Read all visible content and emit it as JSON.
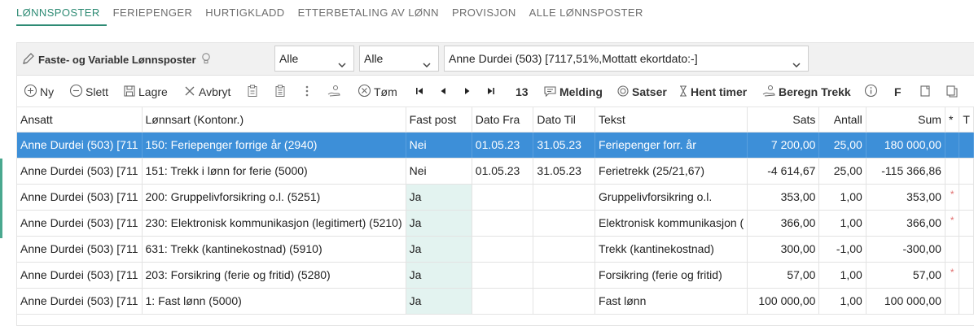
{
  "tabs": [
    {
      "label": "LØNNSPOSTER",
      "active": true
    },
    {
      "label": "FERIEPENGER",
      "active": false
    },
    {
      "label": "HURTIGKLADD",
      "active": false
    },
    {
      "label": "ETTERBETALING AV LØNN",
      "active": false
    },
    {
      "label": "PROVISJON",
      "active": false
    },
    {
      "label": "ALLE LØNNSPOSTER",
      "active": false
    }
  ],
  "filter": {
    "title": "Faste- og Variable Lønnsposter",
    "select1": "Alle",
    "select2": "Alle",
    "employee": "Anne Durdei (503) [7117,51%,Mottatt ekortdato:-]"
  },
  "toolbar": {
    "new": "Ny",
    "delete": "Slett",
    "save": "Lagre",
    "cancel": "Avbryt",
    "clear": "Tøm",
    "count": "13",
    "message": "Melding",
    "rates": "Satser",
    "fetch_hours": "Hent timer",
    "calc_tax": "Beregn Trekk",
    "f_label": "F"
  },
  "table": {
    "headers": {
      "ansatt": "Ansatt",
      "lonnsart": "Lønnsart (Kontonr.)",
      "fastpost": "Fast post",
      "datofra": "Dato Fra",
      "datotil": "Dato Til",
      "tekst": "Tekst",
      "sats": "Sats",
      "antall": "Antall",
      "sum": "Sum",
      "star": "*",
      "extra": "T"
    },
    "rows": [
      {
        "ansatt": "Anne Durdei (503) [711",
        "lonnsart": "150: Feriepenger forrige år (2940)",
        "fastpost": "Nei",
        "datofra": "01.05.23",
        "datotil": "31.05.23",
        "tekst": "Feriepenger forr. år",
        "sats": "7 200,00",
        "antall": "25,00",
        "sum": "180 000,00",
        "star": ""
      },
      {
        "ansatt": "Anne Durdei (503) [711",
        "lonnsart": "151: Trekk i lønn for ferie (5000)",
        "fastpost": "Nei",
        "datofra": "01.05.23",
        "datotil": "31.05.23",
        "tekst": "Ferietrekk (25/21,67)",
        "sats": "-4 614,67",
        "antall": "25,00",
        "sum": "-115 366,86",
        "star": ""
      },
      {
        "ansatt": "Anne Durdei (503) [711",
        "lonnsart": "200: Gruppelivforsikring o.l. (5251)",
        "fastpost": "Ja",
        "datofra": "",
        "datotil": "",
        "tekst": "Gruppelivforsikring o.l.",
        "sats": "353,00",
        "antall": "1,00",
        "sum": "353,00",
        "star": "*"
      },
      {
        "ansatt": "Anne Durdei (503) [711",
        "lonnsart": "230: Elektronisk kommunikasjon (legitimert) (5210)",
        "fastpost": "Ja",
        "datofra": "",
        "datotil": "",
        "tekst": "Elektronisk kommunikasjon (",
        "sats": "366,00",
        "antall": "1,00",
        "sum": "366,00",
        "star": "*"
      },
      {
        "ansatt": "Anne Durdei (503) [711",
        "lonnsart": "631: Trekk (kantinekostnad) (5910)",
        "fastpost": "Ja",
        "datofra": "",
        "datotil": "",
        "tekst": "Trekk (kantinekostnad)",
        "sats": "300,00",
        "antall": "-1,00",
        "sum": "-300,00",
        "star": ""
      },
      {
        "ansatt": "Anne Durdei (503) [711",
        "lonnsart": "203: Forsikring (ferie og fritid) (5280)",
        "fastpost": "Ja",
        "datofra": "",
        "datotil": "",
        "tekst": "Forsikring (ferie og fritid)",
        "sats": "57,00",
        "antall": "1,00",
        "sum": "57,00",
        "star": "*"
      },
      {
        "ansatt": "Anne Durdei (503) [711",
        "lonnsart": "1: Fast lønn (5000)",
        "fastpost": "Ja",
        "datofra": "",
        "datotil": "",
        "tekst": "Fast lønn",
        "sats": "100 000,00",
        "antall": "1,00",
        "sum": "100 000,00",
        "star": ""
      }
    ]
  },
  "colors": {
    "accent": "#2e8b74",
    "selected_row": "#3d8fd8",
    "fast_post_cell": "#e3f3f0",
    "star": "#e07070"
  }
}
